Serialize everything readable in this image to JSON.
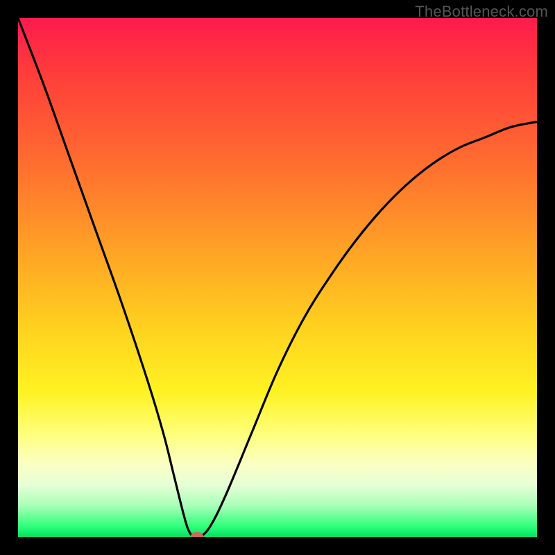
{
  "attribution": "TheBottleneck.com",
  "colors": {
    "frame": "#000000",
    "curve": "#000000",
    "marker": "#cc6b5a",
    "gradient_top": "#ff1a4d",
    "gradient_bottom": "#00e060"
  },
  "chart_data": {
    "type": "line",
    "title": "",
    "xlabel": "",
    "ylabel": "",
    "xlim": [
      0,
      100
    ],
    "ylim": [
      0,
      100
    ],
    "grid": false,
    "legend": false,
    "series": [
      {
        "name": "bottleneck-curve",
        "x": [
          0,
          5,
          10,
          15,
          20,
          25,
          28,
          30,
          32,
          33,
          34,
          35,
          37,
          40,
          45,
          50,
          55,
          60,
          65,
          70,
          75,
          80,
          85,
          90,
          95,
          100
        ],
        "values": [
          100,
          87,
          73,
          59,
          45,
          30,
          20,
          12,
          4,
          1,
          0,
          0,
          2,
          8,
          20,
          32,
          42,
          50,
          57,
          63,
          68,
          72,
          75,
          77,
          79,
          80
        ]
      }
    ],
    "marker": {
      "x": 34.5,
      "y": 0
    }
  }
}
